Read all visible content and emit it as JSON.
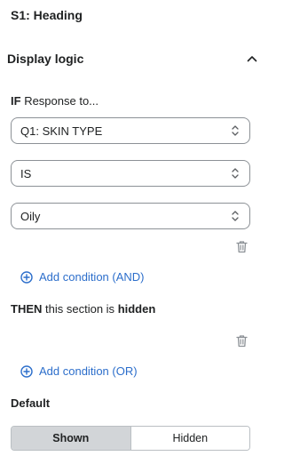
{
  "section": {
    "title": "S1: Heading"
  },
  "display_logic": {
    "title": "Display logic",
    "expanded": true,
    "if_keyword": "IF",
    "if_text": "Response to...",
    "question_select": {
      "value": "Q1: SKIN TYPE"
    },
    "operator_select": {
      "value": "IS"
    },
    "answer_select": {
      "value": "Oily"
    },
    "add_and_label": "Add condition (AND)",
    "then_keyword": "THEN",
    "then_text": "this section is",
    "then_state": "hidden",
    "add_or_label": "Add condition (OR)"
  },
  "default": {
    "label": "Default",
    "options": [
      "Shown",
      "Hidden"
    ],
    "selected": "Shown"
  },
  "colors": {
    "link": "#2c6ecb",
    "text": "#202223",
    "border": "#8c9196",
    "segment_active": "#d2d5d8",
    "icon": "#8c9196"
  },
  "icons": [
    "chevron-up-icon",
    "select-arrows-icon",
    "trash-icon",
    "plus-circle-icon"
  ]
}
